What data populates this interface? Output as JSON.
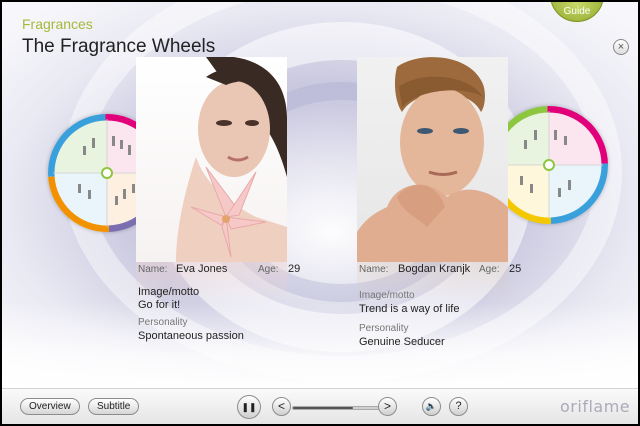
{
  "header": {
    "section": "Fragrances",
    "title": "The Fragrance Wheels"
  },
  "controls": {
    "guide_label": "Guide",
    "close_glyph": "×"
  },
  "profiles": [
    {
      "name_label": "Name:",
      "name": "Eva Jones",
      "age_label": "Age:",
      "age": "29",
      "motto_label": "Image/motto",
      "motto": "Go for it!",
      "personality_label": "Personality",
      "personality": "Spontaneous passion",
      "photo_icon": "woman-with-lily-portrait"
    },
    {
      "name_label": "Name:",
      "name": "Bogdan Kranjk",
      "age_label": "Age:",
      "age": "25",
      "motto_label": "Image/motto",
      "motto": "Trend is a way of life",
      "personality_label": "Personality",
      "personality": "Genuine Seducer",
      "photo_icon": "man-portrait"
    }
  ],
  "wheels": {
    "colors": [
      "#e2007a",
      "#3aa0dc",
      "#f39200",
      "#8dc63f",
      "#7b6fb0"
    ]
  },
  "toolbar": {
    "overview_label": "Overview",
    "subtitle_label": "Subtitle",
    "pause_glyph": "❚❚",
    "prev_glyph": "<",
    "next_glyph": ">",
    "volume_glyph": "🔈",
    "help_glyph": "?",
    "progress": 0.7,
    "logo": "oriflame"
  }
}
